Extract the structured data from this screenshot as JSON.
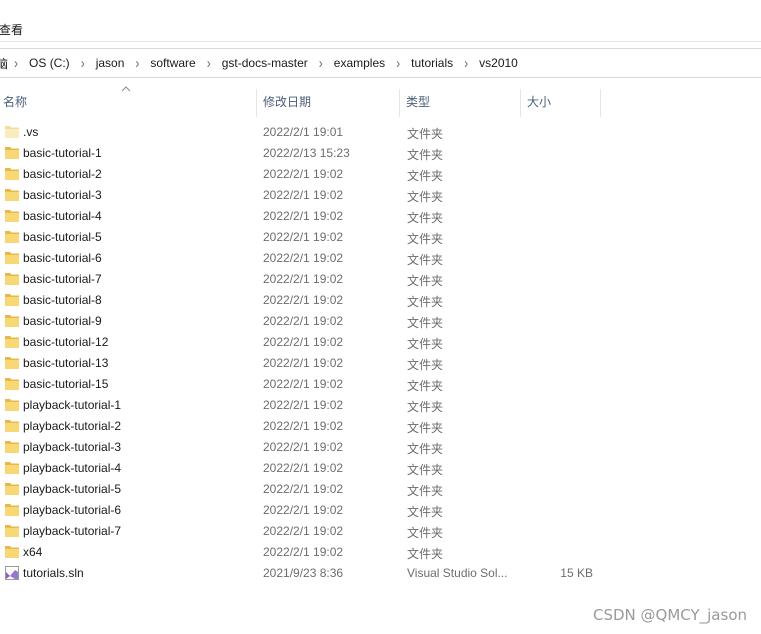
{
  "ribbon": {
    "view_tab": "查看"
  },
  "breadcrumb": {
    "root_fragment": "脑",
    "items": [
      "OS (C:)",
      "jason",
      "software",
      "gst-docs-master",
      "examples",
      "tutorials",
      "vs2010"
    ]
  },
  "columns": {
    "name": "名称",
    "date": "修改日期",
    "type": "类型",
    "size": "大小"
  },
  "files": [
    {
      "name": ".vs",
      "date": "2022/2/1 19:01",
      "type": "文件夹",
      "size": "",
      "icon": "folder-icon-hidden"
    },
    {
      "name": "basic-tutorial-1",
      "date": "2022/2/13 15:23",
      "type": "文件夹",
      "size": "",
      "icon": "folder-icon"
    },
    {
      "name": "basic-tutorial-2",
      "date": "2022/2/1 19:02",
      "type": "文件夹",
      "size": "",
      "icon": "folder-icon"
    },
    {
      "name": "basic-tutorial-3",
      "date": "2022/2/1 19:02",
      "type": "文件夹",
      "size": "",
      "icon": "folder-icon"
    },
    {
      "name": "basic-tutorial-4",
      "date": "2022/2/1 19:02",
      "type": "文件夹",
      "size": "",
      "icon": "folder-icon"
    },
    {
      "name": "basic-tutorial-5",
      "date": "2022/2/1 19:02",
      "type": "文件夹",
      "size": "",
      "icon": "folder-icon"
    },
    {
      "name": "basic-tutorial-6",
      "date": "2022/2/1 19:02",
      "type": "文件夹",
      "size": "",
      "icon": "folder-icon"
    },
    {
      "name": "basic-tutorial-7",
      "date": "2022/2/1 19:02",
      "type": "文件夹",
      "size": "",
      "icon": "folder-icon"
    },
    {
      "name": "basic-tutorial-8",
      "date": "2022/2/1 19:02",
      "type": "文件夹",
      "size": "",
      "icon": "folder-icon"
    },
    {
      "name": "basic-tutorial-9",
      "date": "2022/2/1 19:02",
      "type": "文件夹",
      "size": "",
      "icon": "folder-icon"
    },
    {
      "name": "basic-tutorial-12",
      "date": "2022/2/1 19:02",
      "type": "文件夹",
      "size": "",
      "icon": "folder-icon"
    },
    {
      "name": "basic-tutorial-13",
      "date": "2022/2/1 19:02",
      "type": "文件夹",
      "size": "",
      "icon": "folder-icon"
    },
    {
      "name": "basic-tutorial-15",
      "date": "2022/2/1 19:02",
      "type": "文件夹",
      "size": "",
      "icon": "folder-icon"
    },
    {
      "name": "playback-tutorial-1",
      "date": "2022/2/1 19:02",
      "type": "文件夹",
      "size": "",
      "icon": "folder-icon"
    },
    {
      "name": "playback-tutorial-2",
      "date": "2022/2/1 19:02",
      "type": "文件夹",
      "size": "",
      "icon": "folder-icon"
    },
    {
      "name": "playback-tutorial-3",
      "date": "2022/2/1 19:02",
      "type": "文件夹",
      "size": "",
      "icon": "folder-icon"
    },
    {
      "name": "playback-tutorial-4",
      "date": "2022/2/1 19:02",
      "type": "文件夹",
      "size": "",
      "icon": "folder-icon"
    },
    {
      "name": "playback-tutorial-5",
      "date": "2022/2/1 19:02",
      "type": "文件夹",
      "size": "",
      "icon": "folder-icon"
    },
    {
      "name": "playback-tutorial-6",
      "date": "2022/2/1 19:02",
      "type": "文件夹",
      "size": "",
      "icon": "folder-icon"
    },
    {
      "name": "playback-tutorial-7",
      "date": "2022/2/1 19:02",
      "type": "文件夹",
      "size": "",
      "icon": "folder-icon"
    },
    {
      "name": "x64",
      "date": "2022/2/1 19:02",
      "type": "文件夹",
      "size": "",
      "icon": "folder-icon"
    },
    {
      "name": "tutorials.sln",
      "date": "2021/9/23 8:36",
      "type": "Visual Studio Sol...",
      "size": "15 KB",
      "icon": "visual-studio-solution-icon"
    }
  ],
  "colors": {
    "folder_fill": "#f8d775",
    "folder_back": "#e8b84a",
    "folder_hidden_fill": "#fbecc0",
    "vs_purple": "#865fc5",
    "header_text": "#4c607a",
    "meta_text": "#6d6d6d"
  },
  "watermark": "CSDN @QMCY_jason"
}
